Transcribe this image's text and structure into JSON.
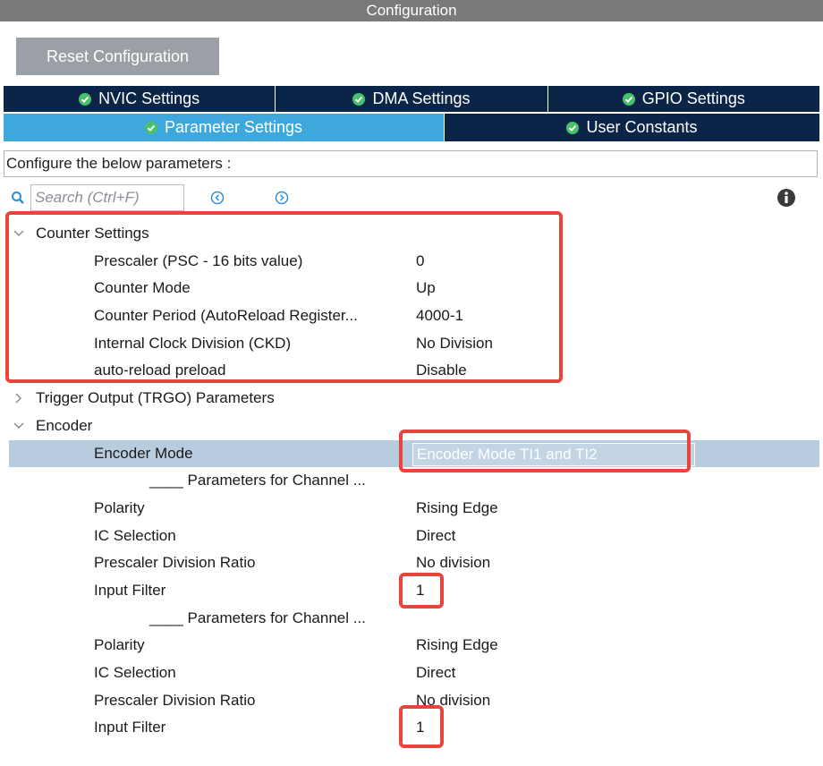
{
  "window": {
    "title": "Configuration"
  },
  "toolbar": {
    "reset_label": "Reset Configuration"
  },
  "tabs": {
    "row1": [
      {
        "label": "NVIC Settings",
        "icon": "check-circle-icon"
      },
      {
        "label": "DMA Settings",
        "icon": "check-circle-icon"
      },
      {
        "label": "GPIO Settings",
        "icon": "check-circle-icon"
      }
    ],
    "row2": [
      {
        "label": "Parameter Settings",
        "icon": "check-circle-icon",
        "active": true
      },
      {
        "label": "User Constants",
        "icon": "check-circle-icon"
      }
    ]
  },
  "description": "Configure the below parameters :",
  "search": {
    "placeholder": "Search (Ctrl+F)"
  },
  "tree": {
    "counter_settings": {
      "title": "Counter Settings",
      "rows": [
        {
          "label": "Prescaler (PSC - 16 bits value)",
          "value": "0"
        },
        {
          "label": "Counter Mode",
          "value": "Up"
        },
        {
          "label": "Counter Period (AutoReload Register...",
          "value": "4000-1"
        },
        {
          "label": "Internal Clock Division (CKD)",
          "value": "No Division"
        },
        {
          "label": "auto-reload preload",
          "value": "Disable"
        }
      ]
    },
    "trgo": {
      "title": "Trigger Output (TRGO) Parameters"
    },
    "encoder": {
      "title": "Encoder",
      "mode_label": "Encoder Mode",
      "mode_value": "Encoder Mode TI1 and TI2",
      "channel1": {
        "header": "____ Parameters for Channel ...",
        "rows": [
          {
            "label": "Polarity",
            "value": "Rising Edge"
          },
          {
            "label": "IC Selection",
            "value": "Direct"
          },
          {
            "label": "Prescaler Division Ratio",
            "value": "No division"
          },
          {
            "label": "Input Filter",
            "value": "1"
          }
        ]
      },
      "channel2": {
        "header": "____ Parameters for Channel ...",
        "rows": [
          {
            "label": "Polarity",
            "value": "Rising Edge"
          },
          {
            "label": "IC Selection",
            "value": "Direct"
          },
          {
            "label": "Prescaler Division Ratio",
            "value": "No division"
          },
          {
            "label": "Input Filter",
            "value": "1"
          }
        ]
      }
    }
  },
  "colors": {
    "tab_dark": "#0b2548",
    "tab_active": "#3ea8dc",
    "check_green": "#49c06a",
    "highlight_red": "#e8453c",
    "selected_row": "#b8cce0"
  }
}
